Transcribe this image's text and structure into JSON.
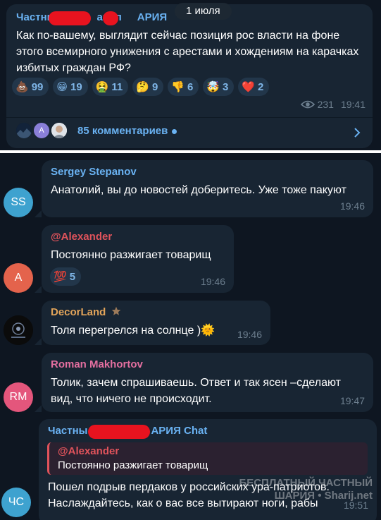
{
  "channel_post": {
    "date": "1 июля",
    "title_left": "Частны",
    "title_mid": "анал",
    "title_right": "АРИЯ",
    "text": "Как по-вашему, выглядит сейчас позиция рос власти на фоне этого всемирного унижения с арестами и хождениям на карачках избитых граждан РФ?",
    "reactions": [
      {
        "emoji": "💩",
        "count": "99"
      },
      {
        "emoji": "😁",
        "count": "19"
      },
      {
        "emoji": "🤮",
        "count": "11"
      },
      {
        "emoji": "🤔",
        "count": "9"
      },
      {
        "emoji": "👎",
        "count": "6"
      },
      {
        "emoji": "🤯",
        "count": "3"
      },
      {
        "emoji": "❤️",
        "count": "2"
      }
    ],
    "views": "231",
    "time": "19:41",
    "comments_label": "85 комментариев",
    "comment_avatar_letter": "A"
  },
  "messages": [
    {
      "avatar_initials": "SS",
      "avatar_color": "#3ea2cf",
      "sender": "Sergey Stepanov",
      "sender_color": "#6ab2f2",
      "text": "Анатолий, вы до новостей доберитесь. Уже тоже пакуют",
      "time": "19:46"
    },
    {
      "avatar_initials": "A",
      "avatar_color": "#e4634c",
      "sender": "@Alexander",
      "sender_color": "#e0535b",
      "text": "Постоянно разжигает товарищ",
      "reaction": {
        "emoji": "💯",
        "count": "5"
      },
      "time": "19:46"
    },
    {
      "sender": "DecorLand",
      "sender_color": "#e2a45a",
      "text": "Толя перегрелся на солнце )🌞",
      "time": "19:46"
    },
    {
      "avatar_initials": "RM",
      "avatar_color": "#e4567c",
      "sender": "Roman Makhortov",
      "sender_color": "#e46fa0",
      "text_line1": "Толик, зачем спрашиваешь. Ответ и так ясен –сделают",
      "text_line2": "вид, что ничего не происходит.",
      "time": "19:47"
    },
    {
      "avatar_initials": "ЧС",
      "avatar_color": "#3ea2cf",
      "sender_left": "Частны",
      "sender_right": "АРИЯ Chat",
      "sender_color": "#6ab2f2",
      "reply_name": "@Alexander",
      "reply_text": "Постоянно разжигает товарищ",
      "text_line1": "Пошел подрыв пердаков у российских ура-патриотов.",
      "text_line2": "Наслаждайтесь, как о вас все вытирают ноги, рабы",
      "time": "19:51"
    }
  ],
  "watermark": {
    "line1": "БЕСПЛАТНЫЙ ЧАСТНЫЙ",
    "line2": "ШАРИЯ • Sharij.net"
  }
}
